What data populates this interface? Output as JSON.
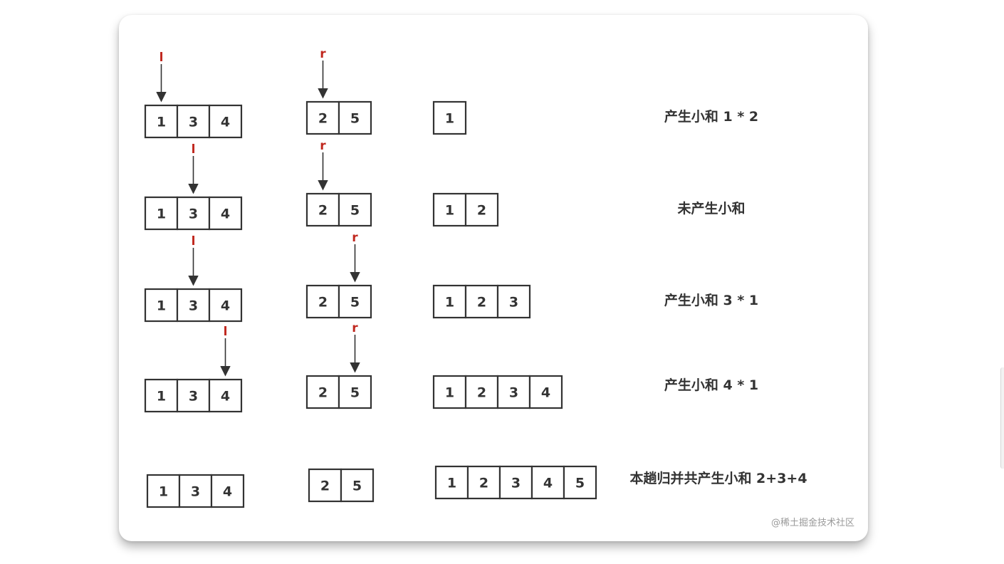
{
  "rows": [
    {
      "left": [
        "1",
        "3",
        "4"
      ],
      "right": [
        "2",
        "5"
      ],
      "merged": [
        "1"
      ],
      "left_pointer": {
        "label": "l",
        "index": 0
      },
      "right_pointer": {
        "label": "r",
        "index": 0
      },
      "note": "产生小和 1 * 2"
    },
    {
      "left": [
        "1",
        "3",
        "4"
      ],
      "right": [
        "2",
        "5"
      ],
      "merged": [
        "1",
        "2"
      ],
      "left_pointer": {
        "label": "l",
        "index": 1
      },
      "right_pointer": {
        "label": "r",
        "index": 0
      },
      "note": "未产生小和"
    },
    {
      "left": [
        "1",
        "3",
        "4"
      ],
      "right": [
        "2",
        "5"
      ],
      "merged": [
        "1",
        "2",
        "3"
      ],
      "left_pointer": {
        "label": "l",
        "index": 1
      },
      "right_pointer": {
        "label": "r",
        "index": 1
      },
      "note": "产生小和 3 * 1"
    },
    {
      "left": [
        "1",
        "3",
        "4"
      ],
      "right": [
        "2",
        "5"
      ],
      "merged": [
        "1",
        "2",
        "3",
        "4"
      ],
      "left_pointer": {
        "label": "l",
        "index": 2
      },
      "right_pointer": {
        "label": "r",
        "index": 1
      },
      "note": "产生小和 4 * 1"
    },
    {
      "left": [
        "1",
        "3",
        "4"
      ],
      "right": [
        "2",
        "5"
      ],
      "merged": [
        "1",
        "2",
        "3",
        "4",
        "5"
      ],
      "left_pointer": null,
      "right_pointer": null,
      "note": "本趟归并共产生小和 2+3+4"
    }
  ],
  "watermark": "@稀土掘金技术社区",
  "colors": {
    "cell_border": "#333333",
    "cell_text": "#333333",
    "pointer_label": "#c0281f",
    "arrow": "#333333",
    "watermark": "#9a9a9a"
  }
}
